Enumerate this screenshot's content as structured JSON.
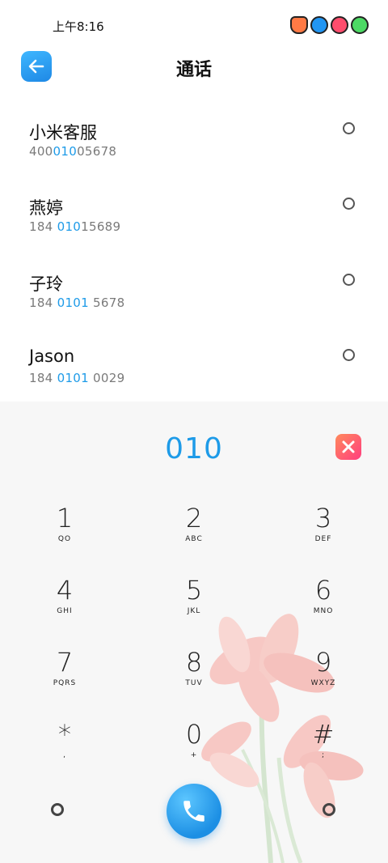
{
  "status_bar": {
    "time": "上午8:16",
    "icons": [
      "app-notification-icon-1",
      "app-notification-icon-2",
      "app-notification-icon-3",
      "app-notification-icon-4"
    ],
    "icon_colors": [
      "#ff7a45",
      "#2196f3",
      "#ff4d6d",
      "#4cd964"
    ]
  },
  "header": {
    "title": "通话",
    "back_icon": "arrow-left-icon"
  },
  "results": [
    {
      "name": "小米客服",
      "number_pre": "400",
      "number_match": "010",
      "number_post": "05678"
    },
    {
      "name": "燕婷",
      "number_pre": "184 ",
      "number_match": "010",
      "number_post": "15689"
    },
    {
      "name": "子玲",
      "number_pre": "184 ",
      "number_match": "0101",
      "number_post": " 5678"
    },
    {
      "name": "Jason",
      "number_pre": "184 ",
      "number_match": "0101",
      "number_post": " 0029"
    }
  ],
  "dialer": {
    "input_value": "010",
    "delete_icon": "close-icon",
    "keys": [
      {
        "digit": "1",
        "letters": "QO"
      },
      {
        "digit": "2",
        "letters": "ABC"
      },
      {
        "digit": "3",
        "letters": "DEF"
      },
      {
        "digit": "4",
        "letters": "GHI"
      },
      {
        "digit": "5",
        "letters": "JKL"
      },
      {
        "digit": "6",
        "letters": "MNO"
      },
      {
        "digit": "7",
        "letters": "PQRS"
      },
      {
        "digit": "8",
        "letters": "TUV"
      },
      {
        "digit": "9",
        "letters": "WXYZ"
      },
      {
        "digit": "*",
        "letters": ","
      },
      {
        "digit": "0",
        "letters": "+"
      },
      {
        "digit": "#",
        "letters": ";"
      }
    ],
    "call_icon": "phone-icon"
  },
  "colors": {
    "accent": "#1e9be8",
    "delete_gradient": [
      "#ff8a5c",
      "#ff3d7f"
    ]
  }
}
